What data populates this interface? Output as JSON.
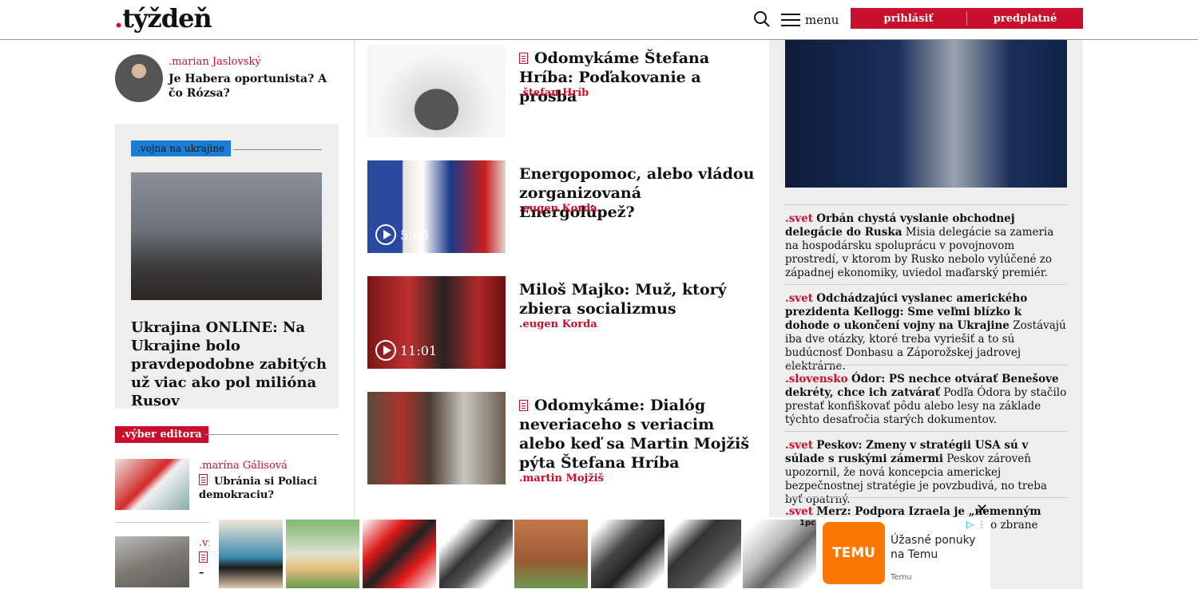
{
  "header": {
    "logo_dot": ".",
    "logo_text": "týždeň",
    "menu_label": "menu",
    "login_label": "prihlásiť",
    "subscribe_label": "predplatné"
  },
  "author_box": {
    "author": ".marian Jaslovský",
    "title": "Je Habera oportunista? A čo Rózsa?"
  },
  "ukraine_box": {
    "tag": ".vojna na ukrajine",
    "title": "Ukrajina ONLINE: Na Ukrajine bolo pravdepodobne zabitých už viac ako pol milióna Rusov"
  },
  "editor_pick": {
    "tag": ".výber editora",
    "items": [
      {
        "author": ".marína Gálisová",
        "title": "Ubránia si Poliaci demokraciu?"
      },
      {
        "author": ".vi",
        "title": "–"
      }
    ]
  },
  "middle": {
    "items": [
      {
        "title": "Odomykáme Štefana Hríba: Poďakovanie a prosba",
        "author": ".štefan Hríb",
        "locked": true
      },
      {
        "title": "Energopomoc, alebo vládou zorganizovaná Energolúpež?",
        "author": ".eugen Korda",
        "video_duration": "5:03"
      },
      {
        "title": "Miloš Majko: Muž, ktorý zbiera socializmus",
        "author": ".eugen Korda",
        "video_duration": "11:01"
      },
      {
        "title": "Odomykáme: Dialóg neveriaceho s veriacim alebo keď sa Martin Mojžiš pýta Štefana Hríba",
        "author": ".martin Mojžiš",
        "locked": true
      }
    ]
  },
  "news": [
    {
      "section": ".svet",
      "headline": "Orbán chystá vyslanie obchodnej delegácie do Ruska",
      "text": "Misia delegácie sa zameria na hospodársku spoluprácu v povojnovom prostredí, v ktorom by Rusko nebolo vylúčené zo západnej ekonomiky, uviedol maďarský premiér."
    },
    {
      "section": ".svet",
      "headline": "Odchádzajúci vyslanec amerického prezidenta Kellogg: Sme veľmi blízko k dohode o ukončení vojny na Ukrajine",
      "text": "Zostávajú iba dve otázky, ktoré treba vyriešiť a to sú budúcnosť Donbasu a Záporožskej jadrovej elektrárne."
    },
    {
      "section": ".slovensko",
      "headline": "Ódor: PS nechce otvárať Benešove dekréty, chce ich zatvárať",
      "text": "Podľa Ódora by stačilo prestať konfiškovať pôdu alebo lesy na základe týchto desaťročia starých dokumentov."
    },
    {
      "section": ".svet",
      "headline": "Peskov: Zmeny v stratégii USA sú v súlade s ruskými zámermi",
      "text": "Peskov zároveň upozornil, že nová koncepcia americkej bezpečnostnej stratégie je povzbudivá, no treba byť opatrný."
    },
    {
      "section": ".svet",
      "headline": "Merz: Podpora Izraela je „nemenným jadrom“",
      "text": "zval, aby bolo moci a aby žilo zbrane"
    }
  ],
  "ad": {
    "close_symbol": "✕",
    "qty_label": "1pc",
    "brand_logo": "TEMU",
    "tagline": "Úžasné ponuky na Temu",
    "brand": "Temu"
  },
  "colors": {
    "accent": "#c8102e",
    "ukraine_tag": "#1a7fd4",
    "temu": "#fb7701",
    "sidebar_bg": "#eeeeee"
  }
}
